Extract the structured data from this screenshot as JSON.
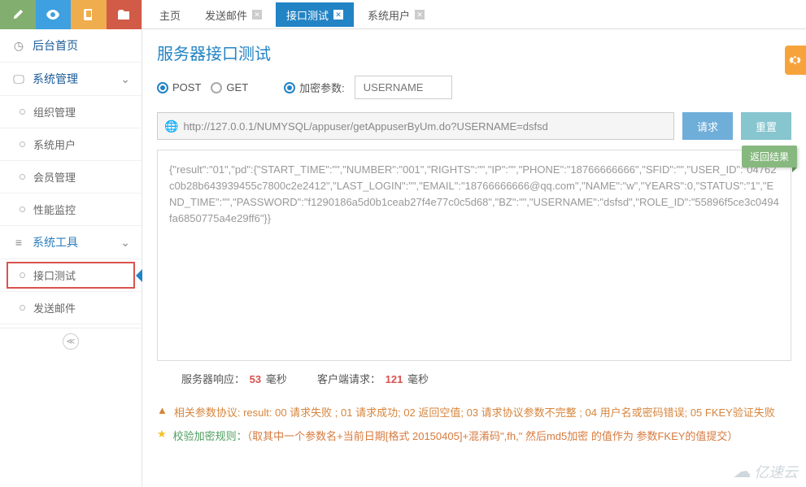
{
  "sidebar": {
    "home": "后台首页",
    "group1": {
      "label": "系统管理"
    },
    "g1items": {
      "i0": "组织管理",
      "i1": "系统用户",
      "i2": "会员管理",
      "i3": "性能监控"
    },
    "group2": {
      "label": "系统工具"
    },
    "g2items": {
      "i0": "接口测试",
      "i1": "发送邮件"
    }
  },
  "tabs": {
    "t0": "主页",
    "t1": "发送邮件",
    "t2": "接口测试",
    "t3": "系统用户"
  },
  "page": {
    "title": "服务器接口测试",
    "post": "POST",
    "get": "GET",
    "param_label": "加密参数:",
    "param_placeholder": "USERNAME",
    "url": "http://127.0.0.1/NUMYSQL/appuser/getAppuserByUm.do?USERNAME=dsfsd",
    "btn_request": "请求",
    "btn_reset": "重置",
    "result_tag": "返回结果",
    "result_text": "{\"result\":\"01\",\"pd\":{\"START_TIME\":\"\",\"NUMBER\":\"001\",\"RIGHTS\":\"\",\"IP\":\"\",\"PHONE\":\"18766666666\",\"SFID\":\"\",\"USER_ID\":\"04762c0b28b643939455c7800c2e2412\",\"LAST_LOGIN\":\"\",\"EMAIL\":\"18766666666@qq.com\",\"NAME\":\"w\",\"YEARS\":0,\"STATUS\":\"1\",\"END_TIME\":\"\",\"PASSWORD\":\"f1290186a5d0b1ceab27f4e77c0c5d68\",\"BZ\":\"\",\"USERNAME\":\"dsfsd\",\"ROLE_ID\":\"55896f5ce3c0494fa6850775a4e29ff6\"}}",
    "timing": {
      "server_label": "服务器响应：",
      "server_value": "53",
      "client_label": "客户端请求：",
      "client_value": "121",
      "unit": "毫秒"
    },
    "note1": "相关参数协议: result: 00 请求失败 ; 01 请求成功; 02 返回空值; 03 请求协议参数不完整 ; 04 用户名或密码错误; 05 FKEY验证失败",
    "note2_a": "校验加密规则：",
    "note2_b": "（取其中一个参数名+当前日期[格式 20150405]+混淆码\",fh,\" 然后md5加密 的值作为 参数FKEY的值提交）"
  },
  "watermark": "亿速云"
}
